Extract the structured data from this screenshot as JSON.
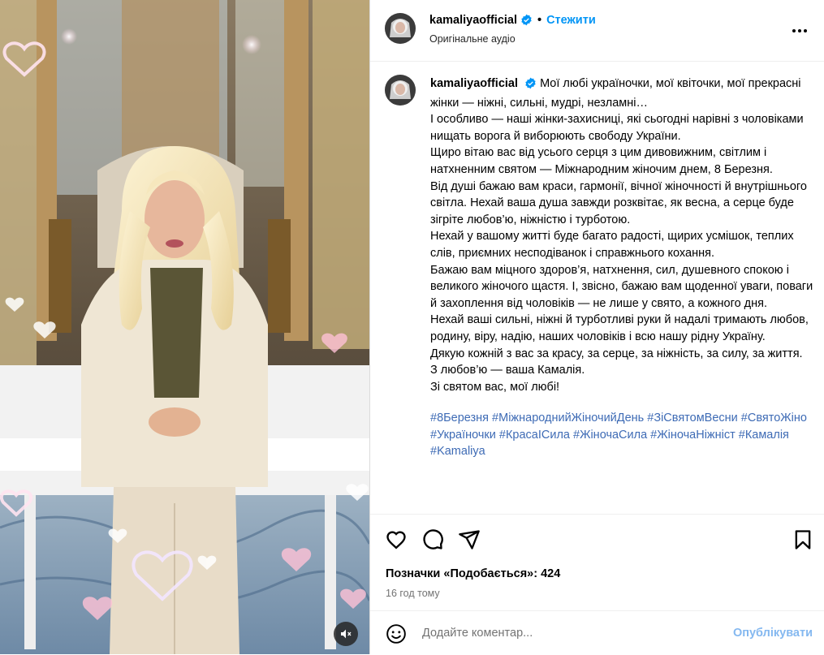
{
  "post": {
    "username": "kamaliyaofficial",
    "follow_label": "Стежити",
    "audio_label": "Оригінальне аудіо",
    "caption_paragraphs": [
      "Мої любі україночки, мої квіточки, мої прекрасні жінки — ніжні, сильні, мудрі, незламні…",
      "І особливо — наші жінки-захисниці, які сьогодні нарівні з чоловіками нищать ворога й виборюють свободу України.",
      "Щиро вітаю вас від усього серця з цим дивовижним, світлим і натхненним святом — Міжнародним жіночим днем, 8 Березня.",
      "Від душі бажаю вам краси, гармонії, вічної жіночності й внутрішнього світла. Нехай ваша душа завжди розквітає, як весна, а серце буде зігріте любов’ю, ніжністю і турботою.",
      "Нехай у вашому житті буде багато радості, щирих усмішок, теплих слів, приємних несподіванок і справжнього кохання.",
      "Бажаю вам міцного здоров’я, натхнення, сил, душевного спокою і великого жіночого щастя. І, звісно, бажаю вам щоденної уваги, поваги й захоплення від чоловіків — не лише у свято, а кожного дня.",
      "Нехай ваші сильні, ніжні й турботливі руки й надалі тримають любов, родину, віру, надію, наших чоловіків і всю нашу рідну Україну.",
      "Дякую кожній з вас за красу, за серце, за ніжність, за силу, за життя.",
      "З любов’ю — ваша Камалія.",
      "Зі святом вас, мої любі!"
    ],
    "hashtags": "#8Березня #МіжнароднийЖіночийДень #ЗіСвятомВесни #СвятоЖіно #Україночки #КрасаІСила #ЖіночаСила #ЖіночаНіжніст #Камалія #Kamaliya",
    "likes_text": "Позначки «Подобається»: 424",
    "time_text": "16 год тому",
    "comment_placeholder": "Додайте коментар...",
    "publish_label": "Опублікувати"
  },
  "icons": {
    "verified": "verified-badge-icon",
    "more": "more-options-icon",
    "like": "heart-icon",
    "comment": "comment-icon",
    "share": "share-icon",
    "save": "bookmark-icon",
    "emoji": "emoji-icon",
    "mute": "muted-speaker-icon"
  },
  "colors": {
    "accent": "#0095f6",
    "hashtag": "#3e6bb5",
    "publish_disabled": "#84b8f0",
    "secondary_text": "#737373"
  }
}
